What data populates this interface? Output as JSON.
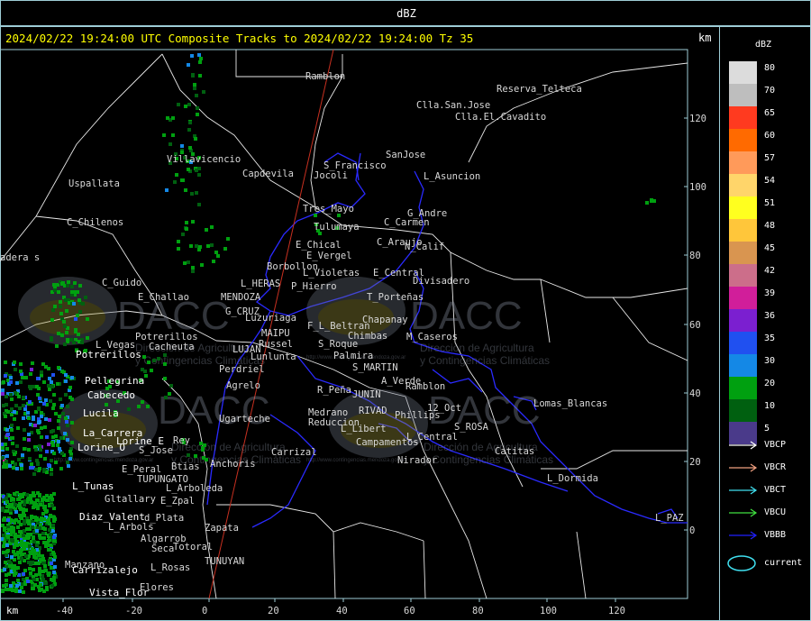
{
  "window": {
    "title": "dBZ",
    "header": "2024/02/22 19:24:00 UTC Composite Tracks to 2024/02/22 19:24:00 Tz 35",
    "km_unit_right": "km",
    "km_unit_bottom": "km"
  },
  "map": {
    "x_ticks": [
      "-40",
      "-20",
      "0",
      "20",
      "40",
      "60",
      "80",
      "100",
      "120"
    ],
    "y_ticks": [
      "120",
      "100",
      "80",
      "60",
      "40",
      "20",
      "0"
    ],
    "places": [
      "Ramblon",
      "Reserva_Telteca",
      "Clla.San.Jose",
      "Clla.El.Cavadito",
      "Villavicencio",
      "Capdevila",
      "S_Francisco",
      "Jocoli",
      "SanJose",
      "L_Asuncion",
      "Uspallata",
      "Tres_Mayo",
      "G_Andre",
      "C_Carmen",
      "Tulumaya",
      "C_Chilenos",
      "E_Chical",
      "C_Araujo",
      "N_Calif",
      "E_Vergel",
      "adera s",
      "Borbollon",
      "E_Central",
      "L_Violetas",
      "Divisadero",
      "C_Guido",
      "L_HERAS",
      "P_Hierro",
      "E_Challao",
      "MENDOZA",
      "T_Porteñas",
      "G_CRUZ",
      "Luzuriaga",
      "F_L_Beltran",
      "Chapanay",
      "MAIPU",
      "Chimbas",
      "Potrerillos",
      "L_Vegas",
      "Cacheuta",
      "M_Caseros",
      "Russel",
      "S_Roque",
      "LUJAN",
      "Palmira",
      "Lunlunta",
      "Perdriel",
      "S_MARTIN",
      "A_Verde",
      "Agrelo",
      "Ramblon",
      "R_Peña",
      "JUNIN",
      "Lomas_Blancas",
      "RIVAD",
      "12_Oct",
      "Medrano",
      "Phillips",
      "Ugarteche",
      "Reduccion",
      "S_ROSA",
      "L_Libert",
      "L_Central",
      "Campamentos",
      "Carrizal",
      "Catitas",
      "Rey",
      "S_Jose",
      "Nirador",
      "Anchoris",
      "Btias",
      "E_Peral",
      "L_Dormida",
      "TUPUNGATO",
      "L_Arboleda",
      "Gltallary",
      "E_Zpal",
      "d_Plata",
      "L_Arbols",
      "Zapata",
      "Algarrob",
      "L_PAZ",
      "Seca",
      "Totoral",
      "TUNUYAN",
      "Manzano",
      "L_Rosas",
      "Elores"
    ],
    "white_places": [
      "Potrerillos",
      "Pellegrina",
      "Cabecedo",
      "Lucila",
      "La_Carrera",
      "Lorine_E",
      "Lorine_O",
      "L_Tunas",
      "Diaz_Valent",
      "Carrizalejo",
      "Vista_Flor"
    ],
    "watermark": {
      "brand": "DACC",
      "line1": "Dirección de Agricultura",
      "line2": "y Contingencias Climáticas",
      "url": "http://www.contingencias.mendoza.gov.ar"
    }
  },
  "legend": {
    "title": "dBZ",
    "scale": [
      {
        "label": "80",
        "color": "#dcdcdc"
      },
      {
        "label": "70",
        "color": "#bebebe"
      },
      {
        "label": "65",
        "color": "#ff3a1f"
      },
      {
        "label": "60",
        "color": "#ff6a00"
      },
      {
        "label": "57",
        "color": "#ff9a5a"
      },
      {
        "label": "54",
        "color": "#ffd56a"
      },
      {
        "label": "51",
        "color": "#ffff1f"
      },
      {
        "label": "48",
        "color": "#ffc63a"
      },
      {
        "label": "45",
        "color": "#d99550"
      },
      {
        "label": "42",
        "color": "#cc6e8a"
      },
      {
        "label": "39",
        "color": "#d11e9a"
      },
      {
        "label": "36",
        "color": "#7b1fd0"
      },
      {
        "label": "35",
        "color": "#2050f0"
      },
      {
        "label": "30",
        "color": "#1488e6"
      },
      {
        "label": "20",
        "color": "#00a010"
      },
      {
        "label": "10",
        "color": "#006010"
      },
      {
        "label": "5",
        "color": "#4a3a8a"
      }
    ],
    "tracks": [
      {
        "label": "VBCP",
        "color": "#ffffff"
      },
      {
        "label": "VBCR",
        "color": "#f0a080"
      },
      {
        "label": "VBCT",
        "color": "#40e0f0"
      },
      {
        "label": "VBCU",
        "color": "#40e040"
      },
      {
        "label": "VBBB",
        "color": "#2020ff"
      }
    ],
    "current_label": "current",
    "current_color": "#40e0f0"
  }
}
